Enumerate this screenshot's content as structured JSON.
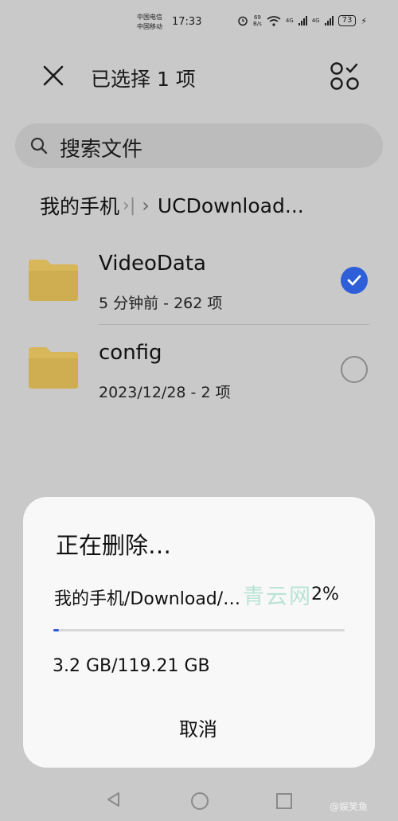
{
  "status_bar": {
    "carrier_1": "中国电信",
    "carrier_2": "中国移动",
    "time": "17:33",
    "speed_value": "69",
    "speed_unit": "B/s",
    "network_1": "4G",
    "network_2": "4G",
    "battery": "73"
  },
  "toolbar": {
    "title": "已选择 1 项"
  },
  "search": {
    "placeholder": "搜索文件"
  },
  "breadcrumb": {
    "root": "我的手机",
    "current": "UCDownload..."
  },
  "files": [
    {
      "name": "VideoData",
      "meta": "5 分钟前 - 262 项",
      "selected": true
    },
    {
      "name": "config",
      "meta": "2023/12/28 - 2 项",
      "selected": false
    }
  ],
  "dialog": {
    "title": "正在删除…",
    "path": "我的手机/Download/…",
    "percent": "2%",
    "progress": 0.02,
    "size": "3.2 GB/119.21 GB",
    "cancel_label": "取消",
    "watermark": "青云网"
  },
  "credit": "@娱笑鱼",
  "colors": {
    "accent": "#2e5fd8",
    "folder": "#d8b65a",
    "dim_background": "#c9c9c9"
  }
}
